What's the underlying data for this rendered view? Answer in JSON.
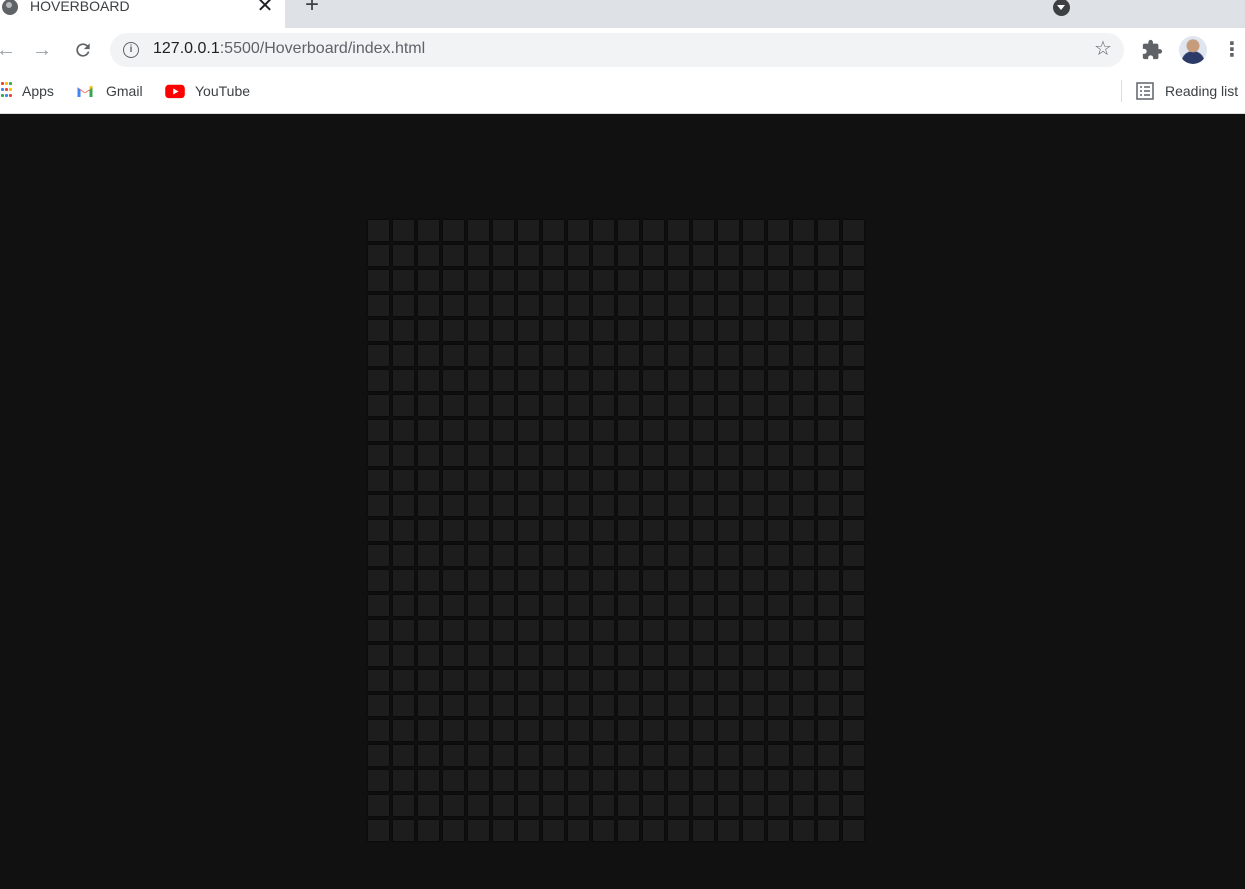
{
  "browser": {
    "tab": {
      "title": "HOVERBOARD",
      "close_icon": "close-icon",
      "favicon": "globe-icon"
    },
    "new_tab_icon": "plus-icon",
    "tab_search_icon": "chevron-down-circle-icon",
    "toolbar": {
      "back_icon": "arrow-left-icon",
      "forward_icon": "arrow-right-icon",
      "reload_icon": "reload-icon",
      "site_info_icon": "info-icon",
      "url_host": "127.0.0.1",
      "url_path": ":5500/Hoverboard/index.html",
      "bookmark_icon": "star-icon",
      "extensions_icon": "puzzle-icon",
      "menu_icon": "kebab-menu-icon"
    },
    "bookmarks": {
      "items": [
        {
          "label": "Apps",
          "icon": "apps-grid-icon"
        },
        {
          "label": "Gmail",
          "icon": "gmail-icon"
        },
        {
          "label": "YouTube",
          "icon": "youtube-icon"
        }
      ],
      "reading_list": {
        "label": "Reading list",
        "icon": "reading-list-icon"
      }
    }
  },
  "page": {
    "background": "#111111",
    "square_color": "#1d1d1d",
    "board": {
      "columns": 20,
      "rows": 25
    }
  }
}
